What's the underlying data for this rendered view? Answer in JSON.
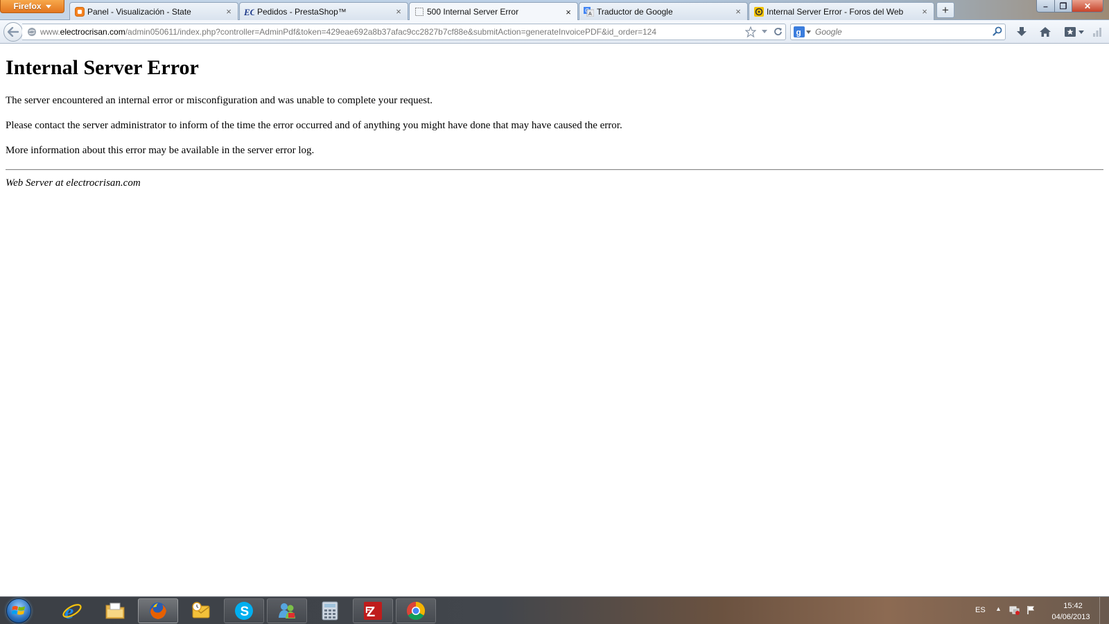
{
  "browser": {
    "menu_button_label": "Firefox",
    "tabs": [
      {
        "title": "Panel - Visualización - State",
        "favicon": "blogger-icon",
        "active": false
      },
      {
        "title": "Pedidos - PrestaShop™",
        "favicon": "electrocrisan-ec-icon",
        "active": false
      },
      {
        "title": "500 Internal Server Error",
        "favicon": "blank-page-icon",
        "active": true
      },
      {
        "title": "Traductor de Google",
        "favicon": "google-translate-icon",
        "active": false
      },
      {
        "title": "Internal Server Error - Foros del Web",
        "favicon": "forosdelweb-icon",
        "active": false
      }
    ],
    "tab_close_glyph": "×",
    "new_tab_glyph": "+",
    "window_controls": {
      "minimize": "–",
      "maximize": "❐",
      "close": "✕"
    },
    "url": {
      "prefix": "www.",
      "host": "electrocrisan.com",
      "path": "/admin050611/index.php?controller=AdminPdf&token=429eae692a8b37afac9cc2827b7cf88e&submitAction=generateInvoicePDF&id_order=124"
    },
    "search": {
      "placeholder": "Google",
      "engine": "google-icon"
    }
  },
  "page": {
    "heading": "Internal Server Error",
    "paragraphs": [
      "The server encountered an internal error or misconfiguration and was unable to complete your request.",
      "Please contact the server administrator to inform of the time the error occurred and of anything you might have done that may have caused the error.",
      "More information about this error may be available in the server error log."
    ],
    "address": "Web Server at electrocrisan.com"
  },
  "taskbar": {
    "items": [
      {
        "name": "internet-explorer-icon"
      },
      {
        "name": "windows-explorer-icon"
      },
      {
        "name": "firefox-icon"
      },
      {
        "name": "outlook-icon"
      },
      {
        "name": "skype-icon"
      },
      {
        "name": "messenger-icon"
      },
      {
        "name": "calculator-icon"
      },
      {
        "name": "filezilla-icon"
      },
      {
        "name": "chrome-icon"
      }
    ],
    "language": "ES",
    "time": "15:42",
    "date": "04/06/2013"
  },
  "colors": {
    "firefox_orange": "#e3761f",
    "link_gray": "#7a7a7a",
    "taskbar": "#3b3f45"
  }
}
